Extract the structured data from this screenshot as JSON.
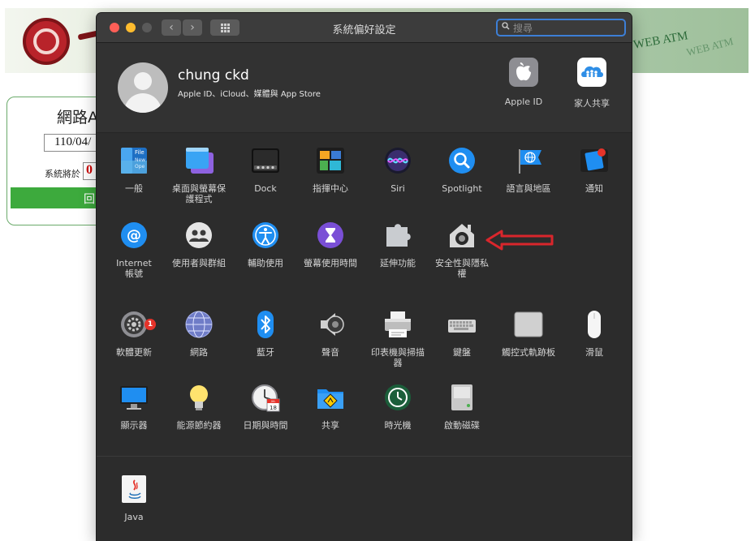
{
  "background_page": {
    "banner_text_1": "WEB ATM",
    "banner_text_2": "WEB ATM",
    "login_title": "網路A",
    "login_date": "110/04/",
    "login_notice": "系統將於",
    "login_red_text": "0",
    "login_button": "回"
  },
  "window": {
    "title": "系統偏好設定",
    "search_placeholder": "搜尋",
    "nav_back": "‹",
    "nav_forward": "›"
  },
  "account": {
    "name": "chung ckd",
    "subtitle": "Apple ID、iCloud、媒體與 App Store",
    "items": [
      {
        "label": "Apple ID",
        "icon": "apple-id-icon"
      },
      {
        "label": "家人共享",
        "icon": "family-sharing-icon"
      }
    ]
  },
  "sections": [
    {
      "rows": [
        [
          {
            "label": "一般",
            "icon": "general-icon"
          },
          {
            "label": "桌面與螢幕保護程式",
            "icon": "desktop-screensaver-icon"
          },
          {
            "label": "Dock",
            "icon": "dock-icon"
          },
          {
            "label": "指揮中心",
            "icon": "mission-control-icon"
          },
          {
            "label": "Siri",
            "icon": "siri-icon"
          },
          {
            "label": "Spotlight",
            "icon": "spotlight-icon"
          },
          {
            "label": "語言與地區",
            "icon": "language-region-icon"
          },
          {
            "label": "通知",
            "icon": "notifications-icon"
          }
        ],
        [
          {
            "label": "Internet 帳號",
            "icon": "internet-accounts-icon"
          },
          {
            "label": "使用者與群組",
            "icon": "users-groups-icon"
          },
          {
            "label": "輔助使用",
            "icon": "accessibility-icon"
          },
          {
            "label": "螢幕使用時間",
            "icon": "screen-time-icon"
          },
          {
            "label": "延伸功能",
            "icon": "extensions-icon"
          },
          {
            "label": "安全性與隱私權",
            "icon": "security-privacy-icon"
          }
        ]
      ]
    },
    {
      "rows": [
        [
          {
            "label": "軟體更新",
            "icon": "software-update-icon",
            "badge": "1"
          },
          {
            "label": "網路",
            "icon": "network-icon"
          },
          {
            "label": "藍牙",
            "icon": "bluetooth-icon"
          },
          {
            "label": "聲音",
            "icon": "sound-icon"
          },
          {
            "label": "印表機與掃描器",
            "icon": "printers-scanners-icon"
          },
          {
            "label": "鍵盤",
            "icon": "keyboard-icon"
          },
          {
            "label": "觸控式軌跡板",
            "icon": "trackpad-icon"
          },
          {
            "label": "滑鼠",
            "icon": "mouse-icon"
          }
        ],
        [
          {
            "label": "顯示器",
            "icon": "displays-icon"
          },
          {
            "label": "能源節約器",
            "icon": "energy-saver-icon"
          },
          {
            "label": "日期與時間",
            "icon": "date-time-icon",
            "icon_text": "JUL 18"
          },
          {
            "label": "共享",
            "icon": "sharing-icon"
          },
          {
            "label": "時光機",
            "icon": "time-machine-icon"
          },
          {
            "label": "啟動磁碟",
            "icon": "startup-disk-icon"
          }
        ]
      ]
    },
    {
      "rows": [
        [
          {
            "label": "Java",
            "icon": "java-icon"
          }
        ]
      ]
    }
  ],
  "colors": {
    "window_bg": "#323232",
    "accent_blue": "#3d7fd6",
    "annotation_red": "#d9262c",
    "badge_red": "#e5332a"
  }
}
